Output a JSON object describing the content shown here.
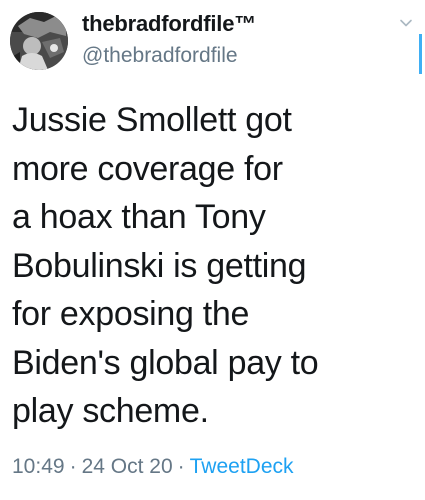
{
  "author": {
    "display_name": "thebradfordfile™",
    "handle": "@thebradfordfile"
  },
  "tweet": {
    "text": "Jussie Smollett got\nmore coverage for\na hoax than Tony\nBobulinski is getting\nfor exposing the\nBiden's global pay to\nplay scheme."
  },
  "meta": {
    "time": "10:49",
    "separator": "·",
    "date": "24 Oct 20",
    "source": "TweetDeck"
  },
  "icons": {
    "menu": "chevron-down-icon",
    "avatar": "avatar"
  },
  "colors": {
    "text": "#14171a",
    "secondary": "#657786",
    "link": "#1da1f2"
  }
}
